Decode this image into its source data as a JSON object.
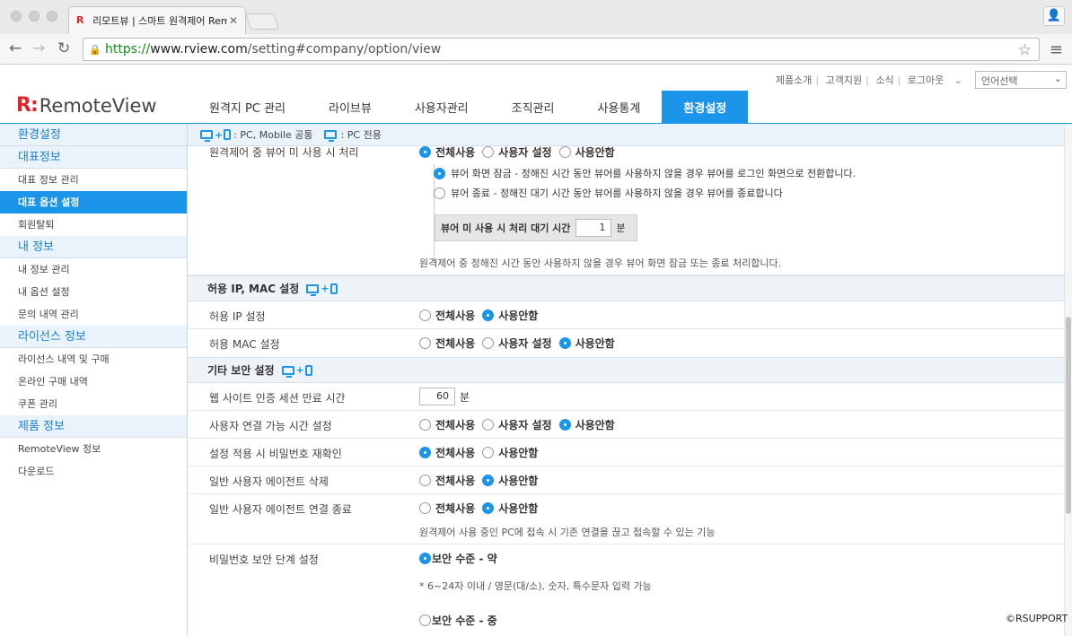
{
  "browser": {
    "tab_title": "리모트뷰 | 스마트 원격제어 Rem",
    "favicon_label": "R",
    "url_scheme": "https://",
    "url_host": "www.rview.com",
    "url_path": "/setting#company/option/view"
  },
  "header": {
    "top_links": [
      "제품소개",
      "고객지원",
      "소식",
      "로그아웃"
    ],
    "language_select": "언어선택",
    "logo_mark": "R:",
    "logo_text": "RemoteView",
    "nav": [
      "원격지 PC 관리",
      "라이브뷰",
      "사용자관리",
      "조직관리",
      "사용통계",
      "환경설정"
    ],
    "active_nav_index": 5
  },
  "sidebar": {
    "title": "환경설정",
    "sections": [
      {
        "head": "대표정보",
        "items": [
          "대표 정보 관리",
          "대표 옵션 설정",
          "회원탈퇴"
        ]
      },
      {
        "head": "내 정보",
        "items": [
          "내 정보 관리",
          "내 옵션 설정",
          "문의 내역 관리"
        ]
      },
      {
        "head": "라이선스 정보",
        "items": [
          "라이선스 내역 및 구매",
          "온라인 구매 내역",
          "쿠폰 관리"
        ]
      },
      {
        "head": "제품 정보",
        "items": [
          "RemoteView 정보",
          "다운로드"
        ]
      }
    ],
    "active_item": "대표 옵션 설정"
  },
  "content": {
    "legend_common": ": PC, Mobile 공통",
    "legend_pc": ": PC 전용",
    "viewer_idle": {
      "label": "원격제어 중 뷰어 미 사용 시 처리",
      "options": [
        "전체사용",
        "사용자 설정",
        "사용안함"
      ],
      "selected": 0,
      "sub_options": [
        "뷰어 화면 잠금 - 정해진 시간 동안 뷰어를 사용하지 않을 경우 뷰어를 로그인 화면으로 전환합니다.",
        "뷰어 종료 - 정해진 대기 시간 동안 뷰어를 사용하지 않을 경우 뷰어를 종료합니다"
      ],
      "sub_selected": 0,
      "wait_label": "뷰어 미 사용 시 처리 대기 시간",
      "wait_value": "1",
      "wait_unit": "분",
      "note": "원격제어 중 정해진 시간 동안 사용하지 않을 경우 뷰어 화면 잠금 또는 종료 처리합니다."
    },
    "section_ip": {
      "title": "허용 IP, MAC 설정",
      "rows": [
        {
          "label": "허용 IP 설정",
          "options": [
            "전체사용",
            "사용안함"
          ],
          "selected": 1
        },
        {
          "label": "허용 MAC 설정",
          "options": [
            "전체사용",
            "사용자 설정",
            "사용안함"
          ],
          "selected": 2
        }
      ]
    },
    "section_security": {
      "title": "기타 보안 설정",
      "session": {
        "label": "웹 사이트 인증 세션 만료 시간",
        "value": "60",
        "unit": "분"
      },
      "rows": [
        {
          "label": "사용자 연결 가능 시간 설정",
          "options": [
            "전체사용",
            "사용자 설정",
            "사용안함"
          ],
          "selected": 2
        },
        {
          "label": "설정 적용 시 비밀번호 재확인",
          "options": [
            "전체사용",
            "사용안함"
          ],
          "selected": 0
        },
        {
          "label": "일반 사용자 에이전트 삭제",
          "options": [
            "전체사용",
            "사용안함"
          ],
          "selected": 1
        },
        {
          "label": "일반 사용자 에이전트 연결 종료",
          "options": [
            "전체사용",
            "사용안함"
          ],
          "selected": 1
        }
      ],
      "agent_note": "원격제어 사용 중인 PC에 접속 시 기존 연결을 끊고 접속할 수 있는 기능",
      "password": {
        "label": "비밀번호 보안 단계 설정",
        "level_low": "보안 수준 - 약",
        "level_low_note": "* 6~24자 이내 / 영문(대/소), 숫자, 특수문자 입력 가능",
        "level_mid": "보안 수준 - 중",
        "selected": "low"
      }
    }
  },
  "footer": {
    "copyright": "©RSUPPORT"
  },
  "colors": {
    "accent": "#1a95e9",
    "brand_red": "#e0232a"
  }
}
